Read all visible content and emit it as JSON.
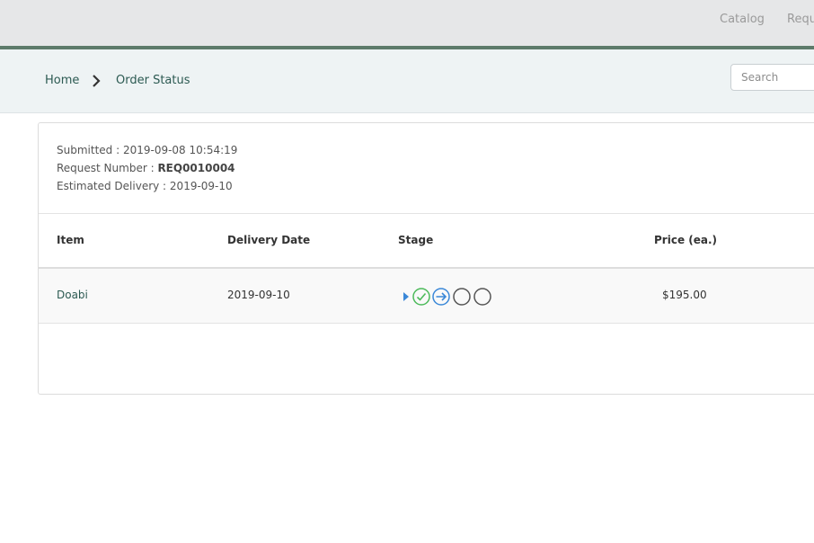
{
  "topnav": {
    "items": [
      "Catalog",
      "Requ"
    ]
  },
  "breadcrumb": {
    "home": "Home",
    "current": "Order Status"
  },
  "search": {
    "placeholder": "Search"
  },
  "order": {
    "submitted_label": "Submitted : ",
    "submitted_value": "2019-09-08 10:54:19",
    "request_label": "Request Number : ",
    "request_value": "REQ0010004",
    "delivery_label": "Estimated Delivery : ",
    "delivery_value": "2019-09-10"
  },
  "table": {
    "headers": [
      "Item",
      "Delivery Date",
      "Stage",
      "Price (ea.)"
    ],
    "rows": [
      {
        "item": "Doabi",
        "delivery_date": "2019-09-10",
        "price": "$195.00",
        "stages": [
          "complete",
          "in-progress",
          "pending",
          "pending"
        ]
      }
    ]
  },
  "colors": {
    "header_accent": "#5d7b6a",
    "link": "#2c5a52",
    "stage_complete": "#4cba5a",
    "stage_active": "#3b88d8",
    "stage_pending": "#555555"
  }
}
